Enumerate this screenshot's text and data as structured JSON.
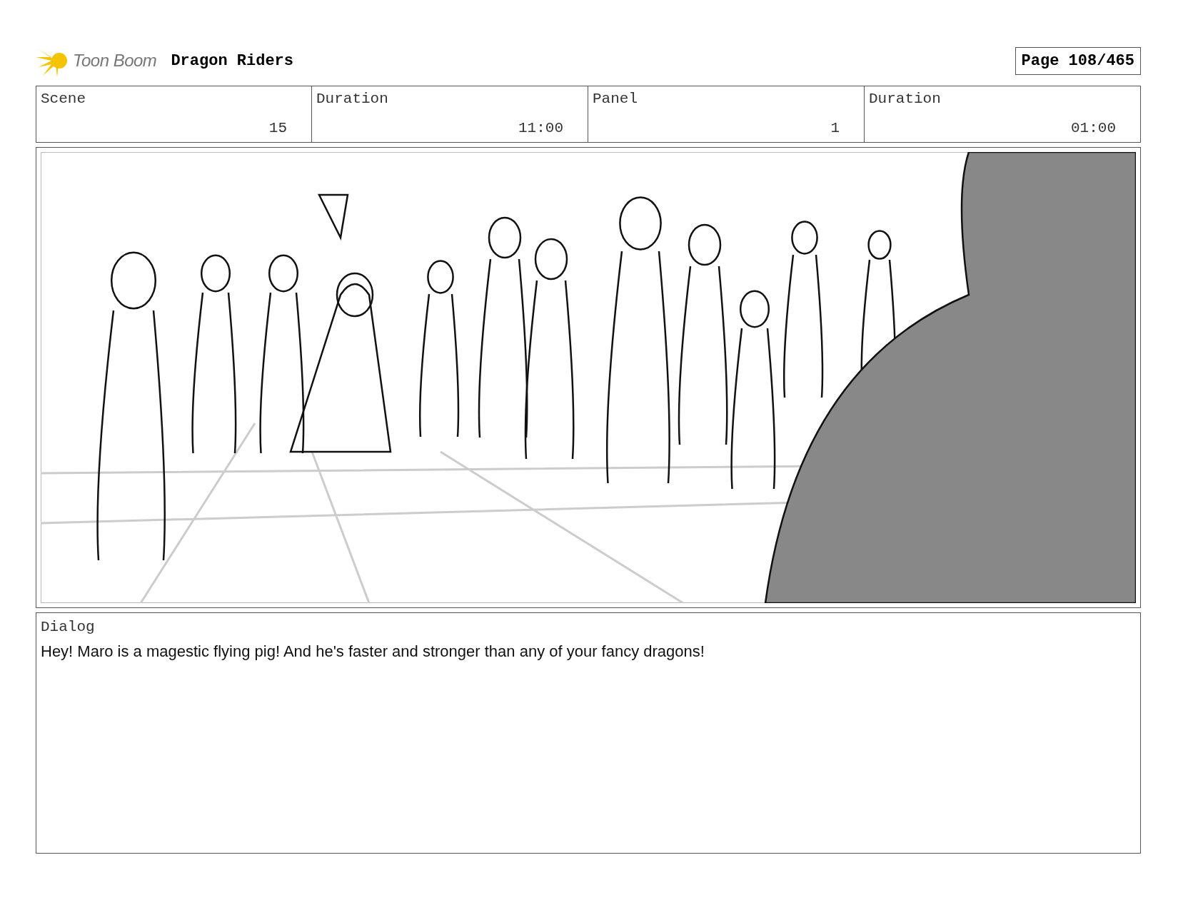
{
  "header": {
    "brand": "Toon Boom",
    "title": "Dragon Riders",
    "page": "Page 108/465"
  },
  "info": [
    {
      "label": "Scene",
      "value": "15"
    },
    {
      "label": "Duration",
      "value": "11:00"
    },
    {
      "label": "Panel",
      "value": "1"
    },
    {
      "label": "Duration",
      "value": "01:00"
    }
  ],
  "panel": {
    "kind": "sketch"
  },
  "dialog": {
    "label": "Dialog",
    "text": "Hey! Maro is a magestic flying pig! And he's faster and stronger than any of your fancy dragons!"
  }
}
